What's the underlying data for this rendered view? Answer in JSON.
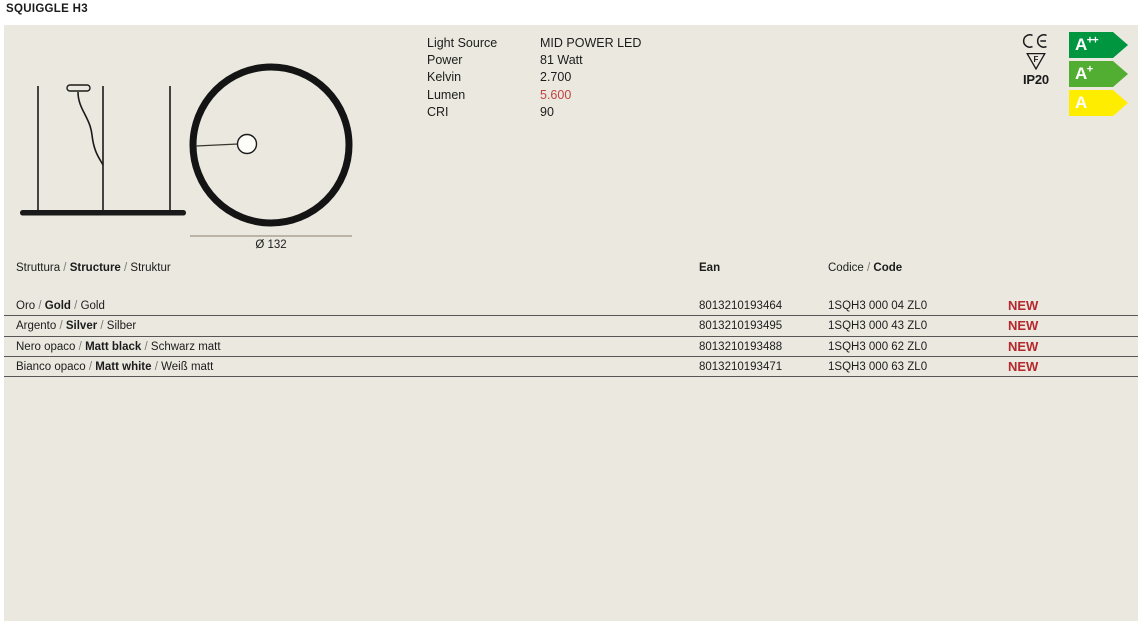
{
  "page": {
    "title": "SQUIGGLE H3"
  },
  "drawing": {
    "dimension_label": "Ø 132",
    "side_view_name": "side-elevation-drawing",
    "top_view_name": "plan-circle-drawing"
  },
  "specs": [
    {
      "label": "Light Source",
      "value": "MID POWER LED",
      "accent": false
    },
    {
      "label": "Power",
      "value": "81 Watt",
      "accent": false
    },
    {
      "label": "Kelvin",
      "value": "2.700",
      "accent": false
    },
    {
      "label": "Lumen",
      "value": "5.600",
      "accent": true
    },
    {
      "label": "CRI",
      "value": "90",
      "accent": false
    }
  ],
  "certifications": {
    "ce_mark": "CE",
    "f_mark": "F",
    "ip_rating": "IP20"
  },
  "energy_labels": [
    {
      "grade": "A",
      "superscript": "++",
      "color": "#009640"
    },
    {
      "grade": "A",
      "superscript": "+",
      "color": "#52ae32"
    },
    {
      "grade": "A",
      "superscript": "",
      "color": "#ffed00"
    }
  ],
  "table": {
    "headers": {
      "structure_it": "Struttura",
      "structure_en": "Structure",
      "structure_de": "Struktur",
      "ean": "Ean",
      "code_it": "Codice",
      "code_en": "Code",
      "separator": "/"
    },
    "rows": [
      {
        "finish_it": "Oro",
        "finish_en": "Gold",
        "finish_de": "Gold",
        "ean": "8013210193464",
        "code": "1SQH3 000 04 ZL0",
        "flag": "NEW"
      },
      {
        "finish_it": "Argento",
        "finish_en": "Silver",
        "finish_de": "Silber",
        "ean": "8013210193495",
        "code": "1SQH3 000 43 ZL0",
        "flag": "NEW"
      },
      {
        "finish_it": "Nero opaco",
        "finish_en": "Matt black",
        "finish_de": "Schwarz matt",
        "ean": "8013210193488",
        "code": "1SQH3 000 62 ZL0",
        "flag": "NEW"
      },
      {
        "finish_it": "Bianco opaco",
        "finish_en": "Matt white",
        "finish_de": "Weiß matt",
        "ean": "8013210193471",
        "code": "1SQH3 000 63 ZL0",
        "flag": "NEW"
      }
    ]
  },
  "colors": {
    "panel_background": "#ebe8df",
    "page_background": "#ffffff",
    "accent_red": "#c0453f",
    "flag_red": "#b5282d",
    "ink": "#1a1a1a"
  }
}
